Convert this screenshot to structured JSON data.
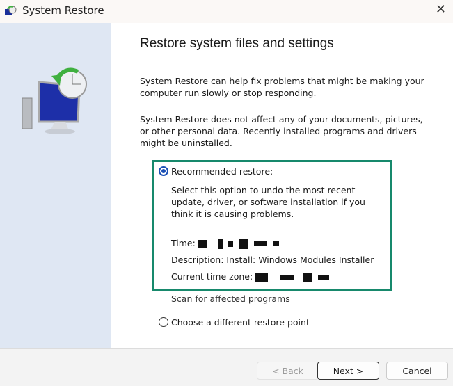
{
  "window": {
    "title": "System Restore",
    "close_label": "✕"
  },
  "main": {
    "heading": "Restore system files and settings",
    "para1": "System Restore can help fix problems that might be making your computer run slowly or stop responding.",
    "para2": "System Restore does not affect any of your documents, pictures, or other personal data. Recently installed programs and drivers might be uninstalled.",
    "recommended": {
      "label": "Recommended restore:",
      "selected": true,
      "description": "Select this option to undo the most recent update, driver, or software installation if you think it is causing problems.",
      "time_label": "Time:",
      "description_line": "Description: Install: Windows Modules Installer",
      "timezone_label": "Current time zone:"
    },
    "scan_link": "Scan for affected programs",
    "different": {
      "label": "Choose a different restore point",
      "selected": false
    }
  },
  "buttons": {
    "back": "< Back",
    "next": "Next >",
    "cancel": "Cancel"
  },
  "colors": {
    "highlight_box": "#17896c",
    "radio_selected": "#1a4fb5",
    "left_panel": "#dfe7f3"
  }
}
